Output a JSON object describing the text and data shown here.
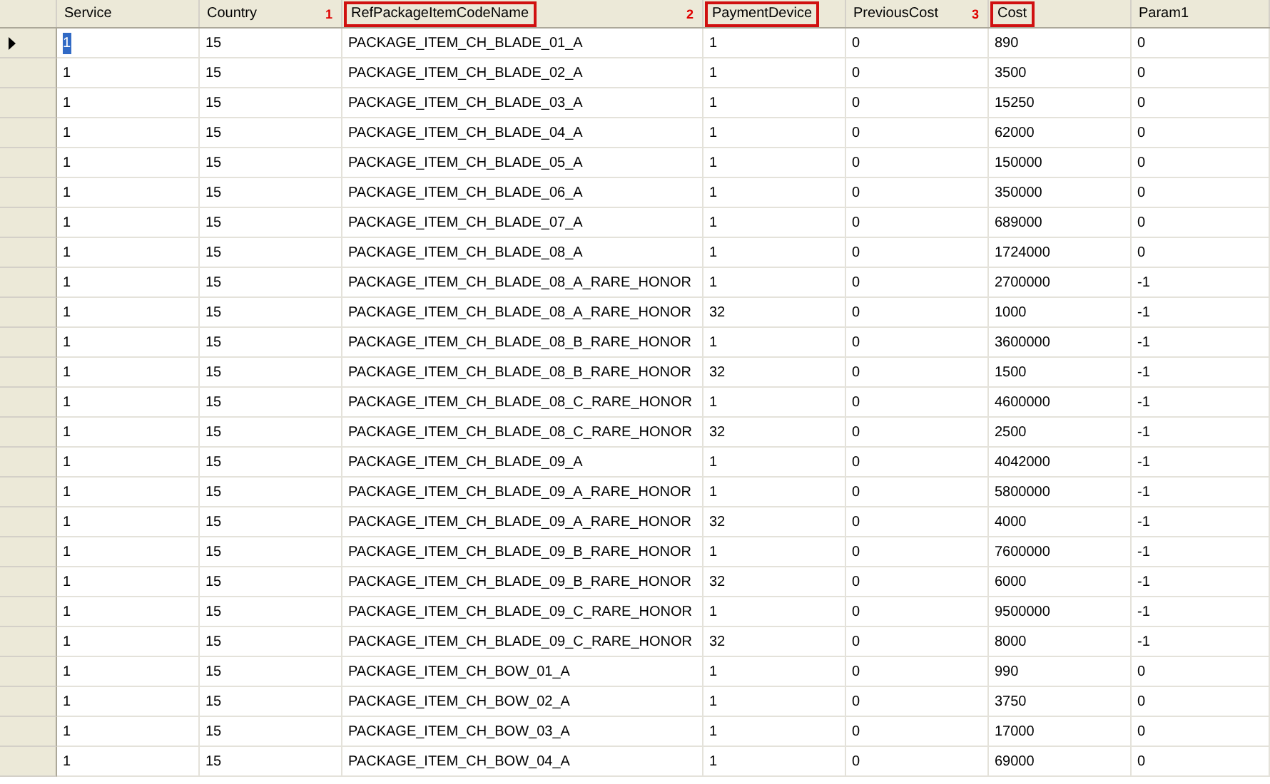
{
  "columns": [
    {
      "label": "Service"
    },
    {
      "label": "Country"
    },
    {
      "label": "RefPackageItemCodeName",
      "marker": "1"
    },
    {
      "label": "PaymentDevice",
      "marker": "2"
    },
    {
      "label": "PreviousCost"
    },
    {
      "label": "Cost",
      "marker": "3"
    },
    {
      "label": "Param1"
    }
  ],
  "rows": [
    {
      "current": true,
      "selected": true,
      "cells": [
        "1",
        "15",
        "PACKAGE_ITEM_CH_BLADE_01_A",
        "1",
        "0",
        "890",
        "0"
      ]
    },
    {
      "current": false,
      "selected": false,
      "cells": [
        "1",
        "15",
        "PACKAGE_ITEM_CH_BLADE_02_A",
        "1",
        "0",
        "3500",
        "0"
      ]
    },
    {
      "current": false,
      "selected": false,
      "cells": [
        "1",
        "15",
        "PACKAGE_ITEM_CH_BLADE_03_A",
        "1",
        "0",
        "15250",
        "0"
      ]
    },
    {
      "current": false,
      "selected": false,
      "cells": [
        "1",
        "15",
        "PACKAGE_ITEM_CH_BLADE_04_A",
        "1",
        "0",
        "62000",
        "0"
      ]
    },
    {
      "current": false,
      "selected": false,
      "cells": [
        "1",
        "15",
        "PACKAGE_ITEM_CH_BLADE_05_A",
        "1",
        "0",
        "150000",
        "0"
      ]
    },
    {
      "current": false,
      "selected": false,
      "cells": [
        "1",
        "15",
        "PACKAGE_ITEM_CH_BLADE_06_A",
        "1",
        "0",
        "350000",
        "0"
      ]
    },
    {
      "current": false,
      "selected": false,
      "cells": [
        "1",
        "15",
        "PACKAGE_ITEM_CH_BLADE_07_A",
        "1",
        "0",
        "689000",
        "0"
      ]
    },
    {
      "current": false,
      "selected": false,
      "cells": [
        "1",
        "15",
        "PACKAGE_ITEM_CH_BLADE_08_A",
        "1",
        "0",
        "1724000",
        "0"
      ]
    },
    {
      "current": false,
      "selected": false,
      "cells": [
        "1",
        "15",
        "PACKAGE_ITEM_CH_BLADE_08_A_RARE_HONOR",
        "1",
        "0",
        "2700000",
        "-1"
      ]
    },
    {
      "current": false,
      "selected": false,
      "cells": [
        "1",
        "15",
        "PACKAGE_ITEM_CH_BLADE_08_A_RARE_HONOR",
        "32",
        "0",
        "1000",
        "-1"
      ]
    },
    {
      "current": false,
      "selected": false,
      "cells": [
        "1",
        "15",
        "PACKAGE_ITEM_CH_BLADE_08_B_RARE_HONOR",
        "1",
        "0",
        "3600000",
        "-1"
      ]
    },
    {
      "current": false,
      "selected": false,
      "cells": [
        "1",
        "15",
        "PACKAGE_ITEM_CH_BLADE_08_B_RARE_HONOR",
        "32",
        "0",
        "1500",
        "-1"
      ]
    },
    {
      "current": false,
      "selected": false,
      "cells": [
        "1",
        "15",
        "PACKAGE_ITEM_CH_BLADE_08_C_RARE_HONOR",
        "1",
        "0",
        "4600000",
        "-1"
      ]
    },
    {
      "current": false,
      "selected": false,
      "cells": [
        "1",
        "15",
        "PACKAGE_ITEM_CH_BLADE_08_C_RARE_HONOR",
        "32",
        "0",
        "2500",
        "-1"
      ]
    },
    {
      "current": false,
      "selected": false,
      "cells": [
        "1",
        "15",
        "PACKAGE_ITEM_CH_BLADE_09_A",
        "1",
        "0",
        "4042000",
        "-1"
      ]
    },
    {
      "current": false,
      "selected": false,
      "cells": [
        "1",
        "15",
        "PACKAGE_ITEM_CH_BLADE_09_A_RARE_HONOR",
        "1",
        "0",
        "5800000",
        "-1"
      ]
    },
    {
      "current": false,
      "selected": false,
      "cells": [
        "1",
        "15",
        "PACKAGE_ITEM_CH_BLADE_09_A_RARE_HONOR",
        "32",
        "0",
        "4000",
        "-1"
      ]
    },
    {
      "current": false,
      "selected": false,
      "cells": [
        "1",
        "15",
        "PACKAGE_ITEM_CH_BLADE_09_B_RARE_HONOR",
        "1",
        "0",
        "7600000",
        "-1"
      ]
    },
    {
      "current": false,
      "selected": false,
      "cells": [
        "1",
        "15",
        "PACKAGE_ITEM_CH_BLADE_09_B_RARE_HONOR",
        "32",
        "0",
        "6000",
        "-1"
      ]
    },
    {
      "current": false,
      "selected": false,
      "cells": [
        "1",
        "15",
        "PACKAGE_ITEM_CH_BLADE_09_C_RARE_HONOR",
        "1",
        "0",
        "9500000",
        "-1"
      ]
    },
    {
      "current": false,
      "selected": false,
      "cells": [
        "1",
        "15",
        "PACKAGE_ITEM_CH_BLADE_09_C_RARE_HONOR",
        "32",
        "0",
        "8000",
        "-1"
      ]
    },
    {
      "current": false,
      "selected": false,
      "cells": [
        "1",
        "15",
        "PACKAGE_ITEM_CH_BOW_01_A",
        "1",
        "0",
        "990",
        "0"
      ]
    },
    {
      "current": false,
      "selected": false,
      "cells": [
        "1",
        "15",
        "PACKAGE_ITEM_CH_BOW_02_A",
        "1",
        "0",
        "3750",
        "0"
      ]
    },
    {
      "current": false,
      "selected": false,
      "cells": [
        "1",
        "15",
        "PACKAGE_ITEM_CH_BOW_03_A",
        "1",
        "0",
        "17000",
        "0"
      ]
    },
    {
      "current": false,
      "selected": false,
      "cells": [
        "1",
        "15",
        "PACKAGE_ITEM_CH_BOW_04_A",
        "1",
        "0",
        "69000",
        "0"
      ]
    }
  ]
}
